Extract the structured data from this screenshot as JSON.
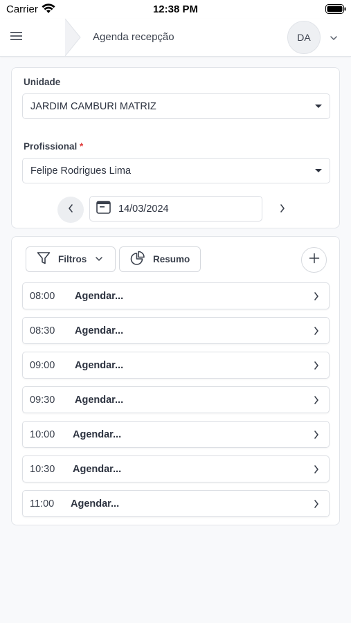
{
  "status_bar": {
    "carrier": "Carrier",
    "time": "12:38 PM"
  },
  "header": {
    "title": "Agenda recepção",
    "avatar_initials": "DA"
  },
  "filters": {
    "unidade_label": "Unidade",
    "unidade_value": "JARDIM CAMBURI MATRIZ",
    "profissional_label": "Profissional",
    "profissional_required_mark": "*",
    "profissional_value": "Felipe Rodrigues Lima",
    "date_value": "14/03/2024"
  },
  "toolbar": {
    "filtros_label": "Filtros",
    "resumo_label": "Resumo"
  },
  "slots": [
    {
      "time": "08:00",
      "label": "Agendar..."
    },
    {
      "time": "08:30",
      "label": "Agendar..."
    },
    {
      "time": "09:00",
      "label": "Agendar..."
    },
    {
      "time": "09:30",
      "label": "Agendar..."
    },
    {
      "time": "10:00",
      "label": "Agendar..."
    },
    {
      "time": "10:30",
      "label": "Agendar..."
    },
    {
      "time": "11:00",
      "label": "Agendar..."
    }
  ],
  "icons": {
    "menu": "hamburger-icon",
    "date": "calendar-icon",
    "filtros": "filter-icon",
    "resumo": "pie-chart-icon",
    "add": "plus-icon",
    "row": "chevron-right-icon"
  },
  "colors": {
    "required": "#e03c3c",
    "text": "#2d3340",
    "border": "#dcdfe4"
  }
}
